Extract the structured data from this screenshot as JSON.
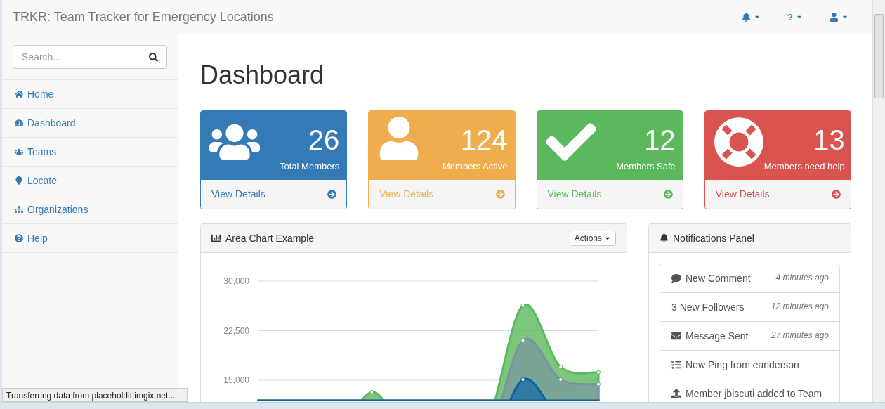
{
  "navbar": {
    "brand": "TRKR: Team Tracker for Emergency Locations",
    "menus": [
      {
        "kind": "bell"
      },
      {
        "kind": "help",
        "label": "?"
      },
      {
        "kind": "user"
      }
    ]
  },
  "sidebar": {
    "search": {
      "placeholder": "Search..."
    },
    "items": [
      {
        "kind": "home",
        "label": "Home"
      },
      {
        "kind": "dashboard",
        "label": "Dashboard"
      },
      {
        "kind": "teams",
        "label": "Teams"
      },
      {
        "kind": "locate",
        "label": "Locate"
      },
      {
        "kind": "organizations",
        "label": "Organizations"
      },
      {
        "kind": "help",
        "label": "Help"
      }
    ]
  },
  "page_title": "Dashboard",
  "stat_cards": [
    {
      "kind": "users",
      "value": "26",
      "label": "Total Members",
      "link": "View Details",
      "color": "#337ab7"
    },
    {
      "kind": "user",
      "value": "124",
      "label": "Members Active",
      "link": "View Details",
      "color": "#f0ad4e"
    },
    {
      "kind": "check",
      "value": "12",
      "label": "Members Safe",
      "link": "View Details",
      "color": "#5cb85c"
    },
    {
      "kind": "lifering",
      "value": "13",
      "label": "Members need help",
      "link": "View Details",
      "color": "#d9534f"
    }
  ],
  "chart_panel": {
    "title": "Area Chart Example",
    "actions": "Actions",
    "axis_labels": [
      "30,000",
      "22,500",
      "15,000"
    ]
  },
  "notifications_panel": {
    "title": "Notifications Panel",
    "items": [
      {
        "kind": "comment",
        "text": "New Comment",
        "time": "4 minutes ago"
      },
      {
        "kind": "none",
        "text": "3 New Followers",
        "time": "12 minutes ago"
      },
      {
        "kind": "envelope",
        "text": "Message Sent",
        "time": "27 minutes ago"
      },
      {
        "kind": "tasks",
        "text": "New Ping from eanderson"
      },
      {
        "kind": "upload",
        "text": "Member jbiscuti added to Team"
      }
    ]
  },
  "status_bar": "Transferring data from placeholdit.imgix.net..."
}
